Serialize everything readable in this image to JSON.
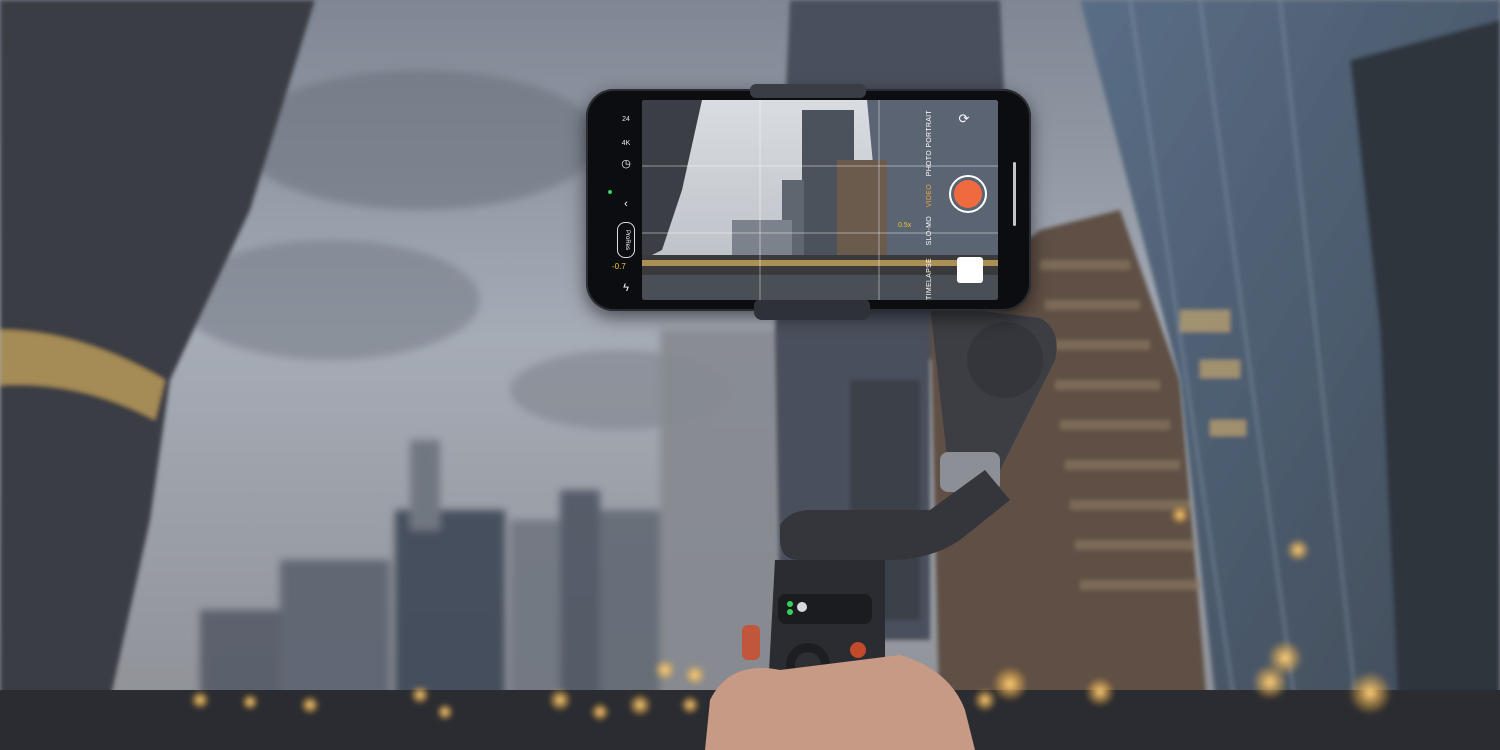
{
  "camera_ui": {
    "frame_rate": "24",
    "resolution": "4K",
    "exposure_value": "-0.7",
    "profile_badge": "ProRes",
    "mode_photo": "PHOTO",
    "mode_video": "VIDEO",
    "mode_portrait": "PORTRAIT",
    "mode_timelapse": "TIMELAPSE",
    "mode_slowmo": "SLO-MO",
    "zoom": "0.5x"
  },
  "gimbal": {
    "status_light": "green"
  },
  "colors": {
    "shutter_accent": "#ef6a3f",
    "active_mode": "#f2a93a",
    "exposure_text": "#f2c335",
    "sky": "#8a919c",
    "street_lights": "#f4b545"
  }
}
